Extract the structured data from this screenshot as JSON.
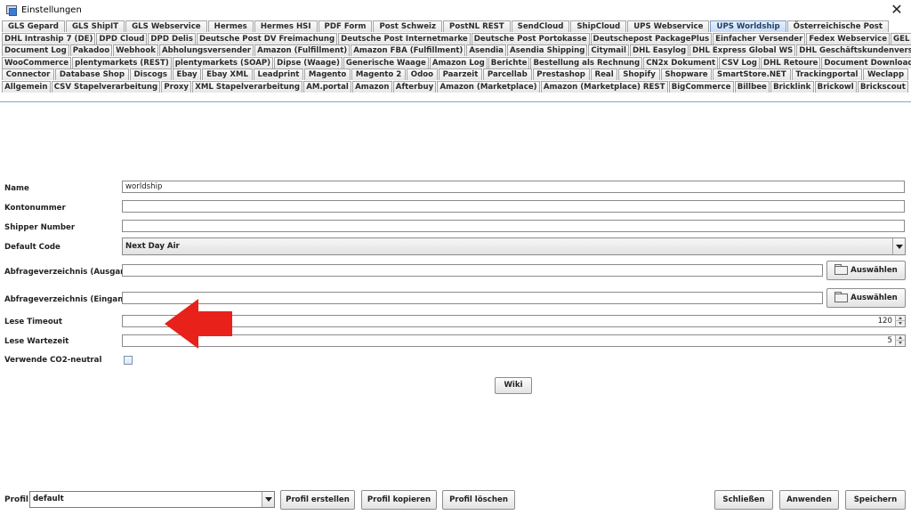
{
  "window": {
    "title": "Einstellungen",
    "close_glyph": "✕"
  },
  "tabs": {
    "rows": [
      [
        "GLS Gepard",
        "GLS ShipIT",
        "GLS Webservice",
        "Hermes",
        "Hermes HSI",
        "PDF Form",
        "Post Schweiz",
        "PostNL REST",
        "SendCloud",
        "ShipCloud",
        "UPS Webservice",
        "UPS Worldship",
        "Österreichische Post"
      ],
      [
        "DHL Intraship 7 (DE)",
        "DPD Cloud",
        "DPD Delis",
        "Deutsche Post DV Freimachung",
        "Deutsche Post Internetmarke",
        "Deutsche Post Portokasse",
        "Deutschepost PackagePlus",
        "Einfacher Versender",
        "Fedex Webservice",
        "GEL Express"
      ],
      [
        "Document Log",
        "Pakadoo",
        "Webhook",
        "Abholungsversender",
        "Amazon (Fulfillment)",
        "Amazon FBA (Fulfillment)",
        "Asendia",
        "Asendia Shipping",
        "Citymail",
        "DHL Easylog",
        "DHL Express Global WS",
        "DHL Geschäftskundenversand"
      ],
      [
        "WooCommerce",
        "plentymarkets (REST)",
        "plentymarkets (SOAP)",
        "Dipse (Waage)",
        "Generische Waage",
        "Amazon Log",
        "Berichte",
        "Bestellung als Rechnung",
        "CN2x Dokument",
        "CSV Log",
        "DHL Retoure",
        "Document Downloader"
      ],
      [
        "Connector",
        "Database Shop",
        "Discogs",
        "Ebay",
        "Ebay XML",
        "Leadprint",
        "Magento",
        "Magento 2",
        "Odoo",
        "Paarzeit",
        "Parcellab",
        "Prestashop",
        "Real",
        "Shopify",
        "Shopware",
        "SmartStore.NET",
        "Trackingportal",
        "Weclapp"
      ],
      [
        "Allgemein",
        "CSV Stapelverarbeitung",
        "Proxy",
        "XML Stapelverarbeitung",
        "AM.portal",
        "Amazon",
        "Afterbuy",
        "Amazon (Marketplace)",
        "Amazon (Marketplace) REST",
        "BigCommerce",
        "Billbee",
        "Bricklink",
        "Brickowl",
        "Brickscout"
      ]
    ],
    "active": "UPS Worldship"
  },
  "form": {
    "name": {
      "label": "Name",
      "value": "worldship"
    },
    "kontonummer": {
      "label": "Kontonummer",
      "value": ""
    },
    "shipper_number": {
      "label": "Shipper Number",
      "value": ""
    },
    "default_code": {
      "label": "Default Code",
      "value": "Next Day Air"
    },
    "abfrage_ausgang": {
      "label": "Abfrageverzeichnis (Ausgang)",
      "value": "",
      "button": "Auswählen"
    },
    "abfrage_eingang": {
      "label": "Abfrageverzeichnis (Eingang)",
      "value": "",
      "button": "Auswählen"
    },
    "lese_timeout": {
      "label": "Lese Timeout",
      "value": "120"
    },
    "lese_wartezeit": {
      "label": "Lese Wartezeit",
      "value": "5"
    },
    "co2_neutral": {
      "label": "Verwende CO2-neutral",
      "checked": false
    },
    "wiki_button": "Wiki"
  },
  "annotation": {
    "arrow_color": "#e8211b"
  },
  "footer": {
    "profil_label": "Profil",
    "profil_value": "default",
    "buttons": {
      "erstellen": "Profil erstellen",
      "kopieren": "Profil kopieren",
      "loeschen": "Profil löschen",
      "schliessen": "Schließen",
      "anwenden": "Anwenden",
      "speichern": "Speichern"
    }
  }
}
